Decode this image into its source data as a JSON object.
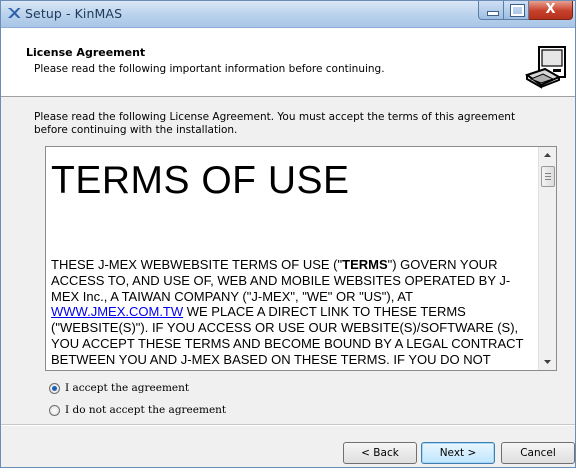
{
  "window": {
    "title": "Setup - KinMAS",
    "minimize_glyph": "–",
    "maximize_glyph": "□",
    "close_glyph": "X"
  },
  "header": {
    "title": "License Agreement",
    "subtitle": "Please read the following important information before continuing.",
    "icon": "setup-computer-icon"
  },
  "instructions": "Please read the following License Agreement. You must accept the terms of this agreement before continuing with the installation.",
  "license": {
    "heading": "TERMS OF USE",
    "para_before_bold": "THESE J-MEX WEBWEBSITE TERMS OF USE (\"",
    "bold_word": "TERMS",
    "para_after_bold": "\") GOVERN YOUR ACCESS TO, AND USE OF, WEB AND MOBILE WEBSITES OPERATED BY J-MEX Inc., A TAIWAN COMPANY (\"J-MEX\", \"WE\" OR \"US\"), AT ",
    "link": "WWW.JMEX.COM.TW",
    "para_after_link": " WE PLACE A DIRECT LINK TO THESE TERMS (\"WEBSITE(S)\"). IF YOU ACCESS OR USE OUR WEBSITE(S)/SOFTWARE (S), YOU ACCEPT THESE TERMS AND BECOME BOUND BY A LEGAL CONTRACT BETWEEN YOU AND J-MEX BASED ON THESE TERMS. IF YOU DO NOT AGREE WITH ANY OF THESE TERMS, DO NOT ACCESS OR"
  },
  "options": {
    "accept_label": "I accept the agreement",
    "decline_label": "I do not accept the agreement",
    "selected": "accept"
  },
  "buttons": {
    "back": "< Back",
    "next": "Next >",
    "cancel": "Cancel"
  },
  "colors": {
    "accent": "#1c5fb6",
    "link": "#0000ee",
    "close_button": "#c7402a"
  }
}
